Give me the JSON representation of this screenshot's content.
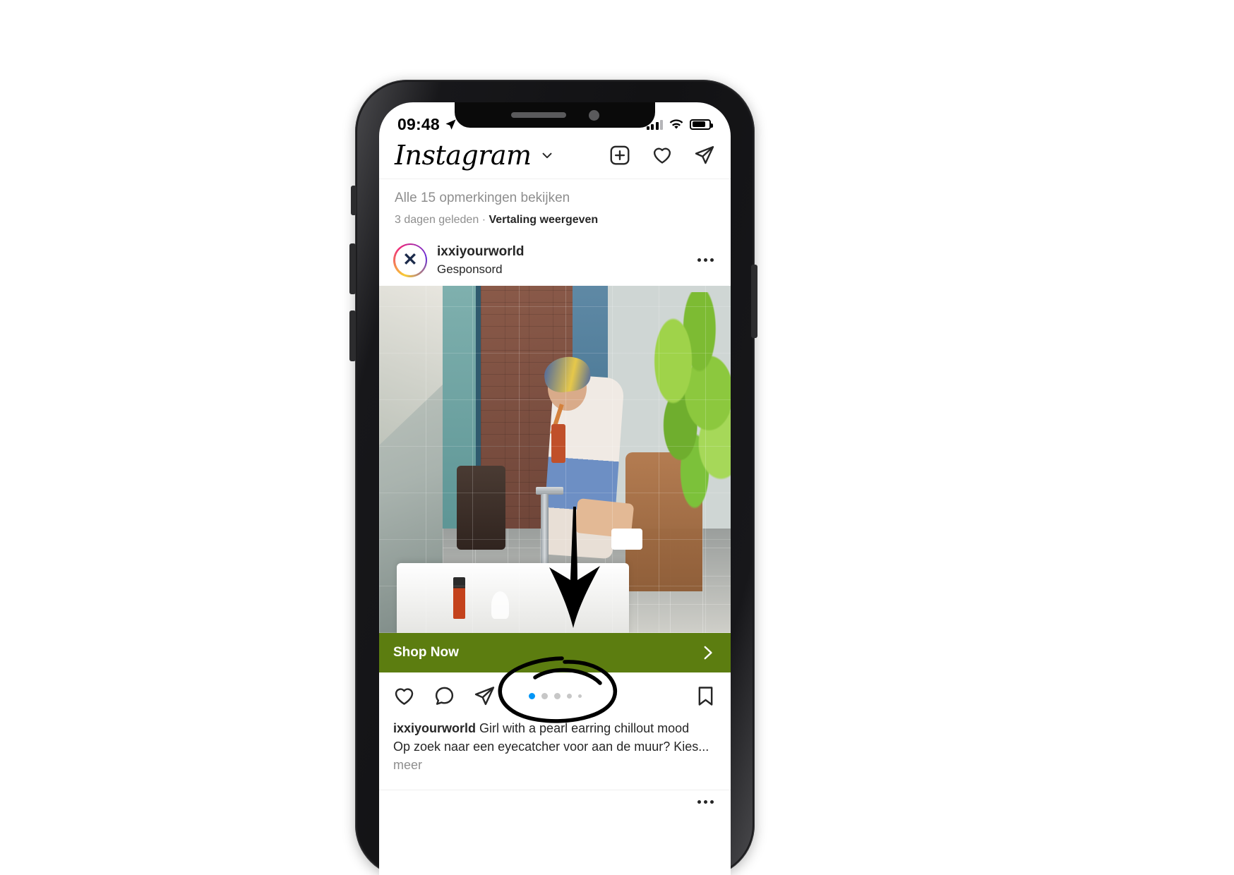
{
  "status_bar": {
    "time": "09:48",
    "location_icon": "location-arrow-icon",
    "signal_icon": "cellular-signal-icon",
    "wifi_icon": "wifi-icon",
    "battery_icon": "battery-icon"
  },
  "header": {
    "logo_text": "Instagram",
    "dropdown_icon": "chevron-down-icon",
    "new_post_icon": "plus-box-icon",
    "activity_icon": "heart-icon",
    "messages_icon": "paper-plane-icon"
  },
  "previous_post": {
    "view_comments": "Alle 15 opmerkingen bekijken",
    "timestamp": "3 dagen geleden",
    "separator": "·",
    "translate": "Vertaling weergeven"
  },
  "sponsored_post": {
    "username": "ixxiyourworld",
    "label": "Gesponsord",
    "avatar_glyph": "✕",
    "more_options_icon": "more-options-icon",
    "cta": {
      "label": "Shop Now",
      "chevron_icon": "chevron-right-icon",
      "background_color": "#5c7d10",
      "text_color": "#ffffff"
    },
    "actions": {
      "like_icon": "heart-icon",
      "comment_icon": "comment-bubble-icon",
      "share_icon": "paper-plane-icon",
      "save_icon": "bookmark-icon"
    },
    "carousel": {
      "total_dots": 5,
      "active_index": 0,
      "active_color": "#0095f6",
      "inactive_color": "#c7c7c7"
    },
    "caption": {
      "username": "ixxiyourworld",
      "line1": " Girl with a pearl earring chillout mood",
      "line2": "Op zoek naar een eyecatcher voor aan de muur? Kies...",
      "more": "meer"
    }
  },
  "next_post_peek": {
    "more_options_icon": "more-options-icon"
  },
  "annotations": {
    "arrow": "down-arrow-annotation",
    "circle": "circle-annotation",
    "color": "#000000"
  }
}
